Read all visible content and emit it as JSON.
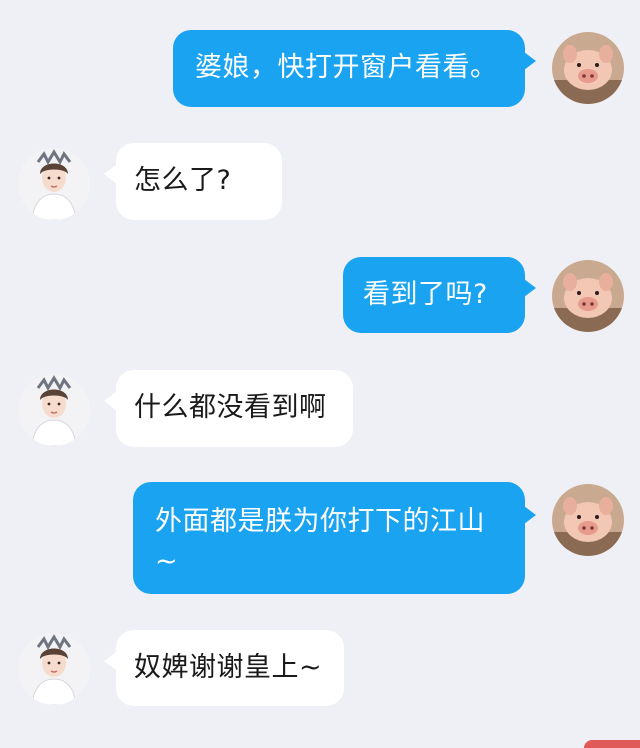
{
  "conversation": {
    "messages": [
      {
        "side": "right",
        "sender": "pig",
        "text": "婆娘，快打开窗户看看。"
      },
      {
        "side": "left",
        "sender": "girl",
        "text": "怎么了?"
      },
      {
        "side": "right",
        "sender": "pig",
        "text": "看到了吗?"
      },
      {
        "side": "left",
        "sender": "girl",
        "text": "什么都没看到啊"
      },
      {
        "side": "right",
        "sender": "pig",
        "text_line1": "外面都是朕为你打下的江山",
        "text_line2": "~"
      },
      {
        "side": "left",
        "sender": "girl",
        "text": "奴婢谢谢皇上~"
      }
    ]
  },
  "colors": {
    "background": "#eef0f6",
    "outgoing_bubble": "#1aa3f0",
    "incoming_bubble": "#ffffff"
  },
  "icons": {
    "outgoing_avatar": "pig-avatar-icon",
    "incoming_avatar": "girl-avatar-icon"
  }
}
